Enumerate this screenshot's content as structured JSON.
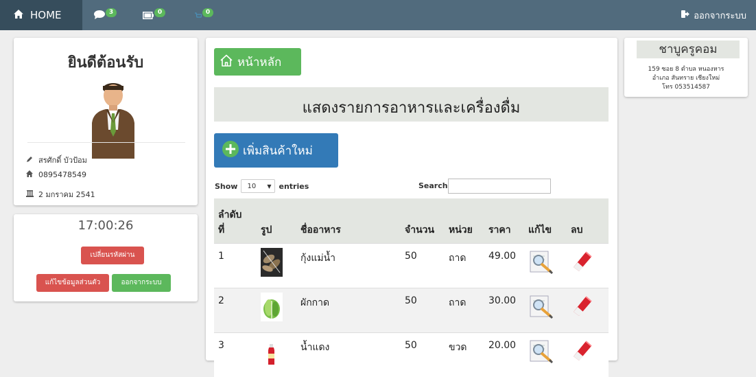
{
  "navbar": {
    "home_label": "HOME",
    "messages_count": "3",
    "tasks_count": "0",
    "cart_count": "0",
    "logout_label": "ออกจากระบบ",
    "badge_color": "#5cb85c"
  },
  "profile": {
    "welcome": "ยินดีต้อนรับ",
    "name": "สรศักดิ์ บัวป้อม",
    "phone": "0895478549",
    "birthdate": "2 มกราคม 2541"
  },
  "account": {
    "clock": "17:00:26",
    "change_password": "เปลี่ยนรหัสผ่าน",
    "edit_profile": "แก้ไขข้อมูลส่วนตัว",
    "logout": "ออกจากระบบ"
  },
  "main": {
    "home_button": "หน้าหลัก",
    "heading": "แสดงรายการอาหารและเครื่องดื่ม",
    "add_button": "เพิ่มสินค้าใหม่",
    "show_label": "Show",
    "entries_value": "10",
    "entries_label": "entries",
    "search_label": "Search:",
    "search_value": ""
  },
  "table": {
    "headers": {
      "no_line1": "ลำดับ",
      "no_line2": "ที่",
      "image": "รูป",
      "name": "ชื่ออาหาร",
      "qty": "จำนวน",
      "unit": "หน่วย",
      "price": "ราคา",
      "edit": "แก้ไข",
      "delete": "ลบ"
    },
    "rows": [
      {
        "no": "1",
        "name": "กุ้งแม่น้ำ",
        "qty": "50",
        "unit": "ถาด",
        "price": "49.00",
        "image_icon": "shrimp-icon"
      },
      {
        "no": "2",
        "name": "ผักกาด",
        "qty": "50",
        "unit": "ถาด",
        "price": "30.00",
        "image_icon": "lettuce-icon"
      },
      {
        "no": "3",
        "name": "น้ำแดง",
        "qty": "50",
        "unit": "ขวด",
        "price": "20.00",
        "image_icon": "red-soda-bottle-icon"
      }
    ]
  },
  "shop": {
    "name": "ชาบูครูคอม",
    "address1": "159 ซอย 8 ตำบล หนองหาร",
    "address2": "อำเภอ สันทราย เชียงใหม่",
    "phone": "โทร 053514587"
  },
  "colors": {
    "navbar": "#516b7d",
    "home_tab": "#364d5c",
    "success": "#5cb85c",
    "primary": "#337ab7",
    "danger": "#d9534f",
    "heading_bg": "#e3e6e1"
  }
}
